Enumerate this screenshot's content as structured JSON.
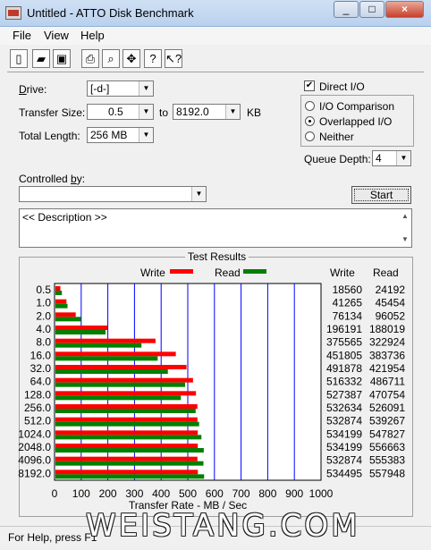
{
  "window": {
    "title": "Untitled - ATTO Disk Benchmark"
  },
  "menu": [
    "File",
    "View",
    "Help"
  ],
  "toolbar": [
    "new-icon",
    "open-icon",
    "save-icon",
    "print-icon",
    "print-preview-icon",
    "move-icon",
    "help-icon",
    "context-help-icon"
  ],
  "settings": {
    "drive_label": "Drive:",
    "drive_value": "[-d-]",
    "transfer_label": "Transfer Size:",
    "transfer_from": "0.5",
    "to_label": "to",
    "transfer_to": "8192.0",
    "kb_label": "KB",
    "total_label": "Total Length:",
    "total_value": "256 MB",
    "controlled_label": "Controlled by:",
    "description": "<< Description >>"
  },
  "io": {
    "direct_label": "Direct I/O",
    "direct_checked": true,
    "options": [
      "I/O Comparison",
      "Overlapped I/O",
      "Neither"
    ],
    "selected": "Overlapped I/O",
    "queue_label": "Queue Depth:",
    "queue_value": "4",
    "start_label": "Start"
  },
  "results": {
    "title": "Test Results",
    "legend_write": "Write",
    "legend_read": "Read",
    "col_write": "Write",
    "col_read": "Read",
    "write_color": "#ff0000",
    "read_color": "#008000"
  },
  "chart_data": {
    "type": "bar",
    "orientation": "horizontal",
    "categories": [
      "0.5",
      "1.0",
      "2.0",
      "4.0",
      "8.0",
      "16.0",
      "32.0",
      "64.0",
      "128.0",
      "256.0",
      "512.0",
      "1024.0",
      "2048.0",
      "4096.0",
      "8192.0"
    ],
    "series": [
      {
        "name": "Write",
        "values": [
          18560,
          41265,
          76134,
          196191,
          375565,
          451805,
          491878,
          516332,
          527387,
          532634,
          532874,
          534199,
          534199,
          532874,
          534495
        ]
      },
      {
        "name": "Read",
        "values": [
          24192,
          45454,
          96052,
          188019,
          322924,
          383736,
          421954,
          486711,
          470754,
          526091,
          539267,
          547827,
          556663,
          555383,
          557948
        ]
      }
    ],
    "xlabel": "Transfer Rate - MB / Sec",
    "xlim": [
      0,
      1000
    ],
    "xticks": [
      "0",
      "100",
      "200",
      "300",
      "400",
      "500",
      "600",
      "700",
      "800",
      "900",
      "1000"
    ]
  },
  "status": {
    "text": "For Help, press F1"
  },
  "watermark": "WEISTANG.COM"
}
